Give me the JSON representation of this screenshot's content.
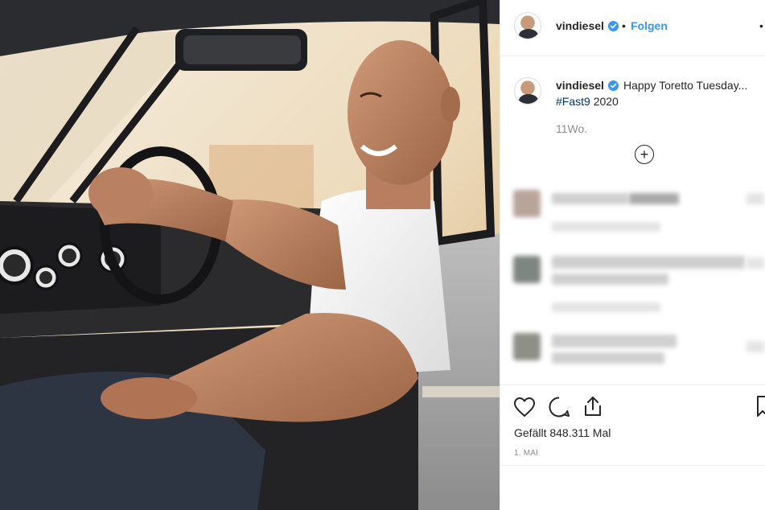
{
  "post": {
    "username": "vindiesel",
    "follow_label": "Folgen",
    "separator": "•",
    "more_label": "•",
    "caption_text": "Happy Toretto Tuesday...",
    "caption_hashtag": "#Fast9",
    "caption_year": "2020",
    "age": "11Wo.",
    "expand_icon": "plus-circle-icon",
    "likes_text": "Gefällt 848.311 Mal",
    "date": "1. MAI"
  },
  "colors": {
    "accent": "#3897f0",
    "hashtag": "#003569",
    "muted": "#8e8e8e",
    "text": "#262626"
  },
  "icons": [
    "heart-icon",
    "comment-icon",
    "share-icon",
    "bookmark-icon",
    "verified-badge-icon"
  ]
}
